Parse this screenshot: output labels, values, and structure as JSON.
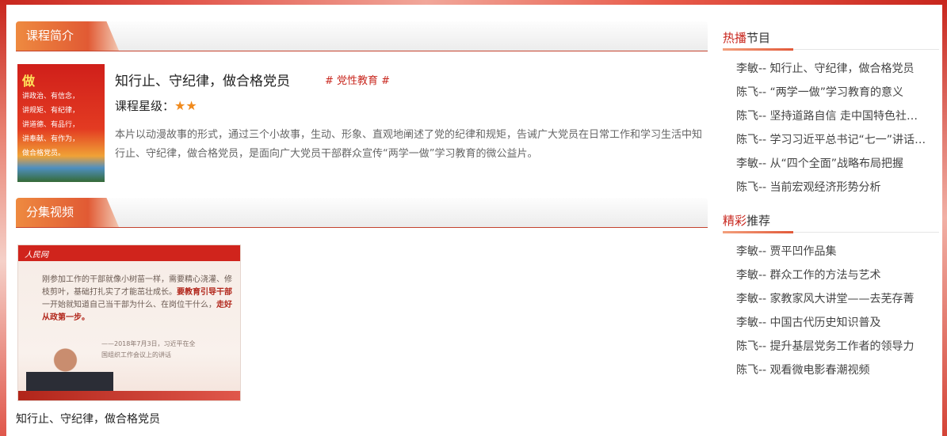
{
  "intro_section": {
    "header": "课程简介",
    "course_title": "知行止、守纪律，做合格党员",
    "tag": "# 党性教育 #",
    "rating_label": "课程星级：",
    "rating_stars": 2,
    "description": "本片以动漫故事的形式，通过三个小故事，生动、形象、直观地阐述了党的纪律和规矩，告诫广大党员在日常工作和学习生活中知行止、守纪律，做合格党员，是面向广大党员干部群众宣传“两学一做”学习教育的微公益片。",
    "poster": {
      "title": "做",
      "lines": [
        "讲政治、有信念，",
        "讲规矩、有纪律，",
        "讲道德、有品行，",
        "讲奉献、有作为，",
        "做合格党员。"
      ]
    }
  },
  "episodes_section": {
    "header": "分集视频",
    "thumbnail": {
      "logo": "人民网",
      "quote_plain_1": "刚参加工作的干部就像小树苗一样，需要精心浇灌、修枝剪叶，基础打扎实了才能茁壮成长。",
      "quote_bold_1": "要教育引导干部",
      "quote_plain_2": "一开始就知道自己当干部为什么、在岗位干什么，",
      "quote_bold_2": "走好从政第一步。",
      "signature_1": "——2018年7月3日，习近平在全",
      "signature_2": "国组织工作会议上的讲话"
    },
    "video_caption": "知行止、守纪律，做合格党员"
  },
  "hot_programs": {
    "heading_highlight": "热播",
    "heading_rest": "节目",
    "items": [
      "李敏-- 知行止、守纪律，做合格党员",
      "陈飞-- “两学一做”学习教育的意义",
      "陈飞-- 坚持道路自信 走中国特色社会主义道路",
      "陈飞-- 学习习近平总书记“七一”讲话精神",
      "李敏-- 从“四个全面”战略布局把握",
      "陈飞-- 当前宏观经济形势分析"
    ]
  },
  "recommended": {
    "heading_highlight": "精彩",
    "heading_rest": "推荐",
    "items": [
      "李敏-- 贾平凹作品集",
      "李敏-- 群众工作的方法与艺术",
      "李敏-- 家教家风大讲堂——去芜存菁",
      "李敏-- 中国古代历史知识普及",
      "陈飞-- 提升基层党务工作者的领导力",
      "陈飞-- 观看微电影春潮视频"
    ]
  },
  "colors": {
    "accent": "#c8261d",
    "tab_orange": "#ee8a40",
    "star": "#f08a1d"
  }
}
